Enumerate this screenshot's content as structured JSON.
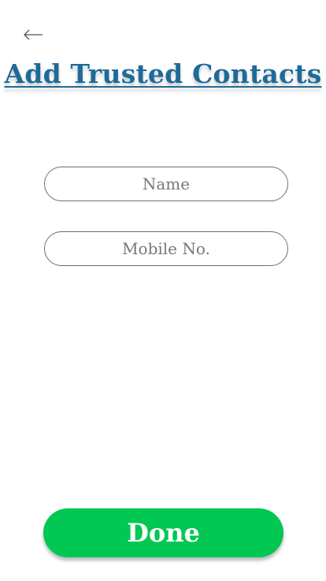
{
  "header": {
    "back_icon": "arrow-left-icon",
    "title": "Add Trusted Contacts",
    "title_color": "#1f6a99"
  },
  "form": {
    "name_placeholder": "Name",
    "name_value": "",
    "mobile_placeholder": "Mobile No.",
    "mobile_value": ""
  },
  "actions": {
    "done_label": "Done",
    "done_color": "#00c853"
  }
}
